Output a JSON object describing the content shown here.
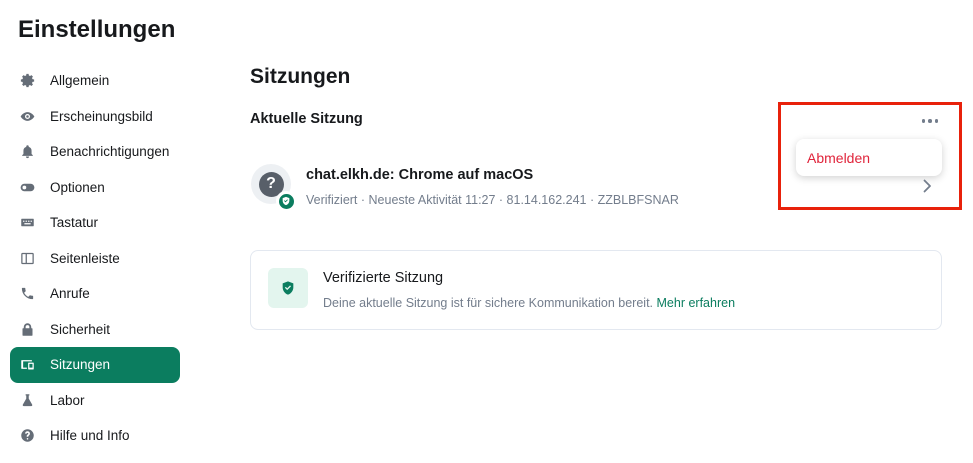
{
  "app": {
    "title": "Einstellungen"
  },
  "sidebar": {
    "items": [
      {
        "label": "Allgemein",
        "icon": "gear-icon"
      },
      {
        "label": "Erscheinungsbild",
        "icon": "eye-icon"
      },
      {
        "label": "Benachrichtigungen",
        "icon": "bell-icon"
      },
      {
        "label": "Optionen",
        "icon": "toggle-icon"
      },
      {
        "label": "Tastatur",
        "icon": "keyboard-icon"
      },
      {
        "label": "Seitenleiste",
        "icon": "sidebar-icon"
      },
      {
        "label": "Anrufe",
        "icon": "phone-icon"
      },
      {
        "label": "Sicherheit",
        "icon": "lock-icon"
      },
      {
        "label": "Sitzungen",
        "icon": "devices-icon",
        "active": true
      },
      {
        "label": "Labor",
        "icon": "flask-icon"
      },
      {
        "label": "Hilfe und Info",
        "icon": "help-icon"
      }
    ]
  },
  "main": {
    "title": "Sitzungen",
    "current_session_heading": "Aktuelle Sitzung",
    "menu": {
      "signout_label": "Abmelden"
    },
    "session": {
      "name": "chat.elkh.de: Chrome auf macOS",
      "meta": "Verifiziert · Neueste Aktivität 11:27 · 81.14.162.241 · ZZBLBFSNAR",
      "avatar_glyph": "?"
    },
    "verified_card": {
      "title": "Verifizierte Sitzung",
      "description": "Deine aktuelle Sitzung ist für sichere Kommunikation bereit.",
      "link": "Mehr erfahren"
    }
  },
  "colors": {
    "accent": "#0b7d5f",
    "danger": "#e0243b",
    "highlight": "#e8210b"
  }
}
